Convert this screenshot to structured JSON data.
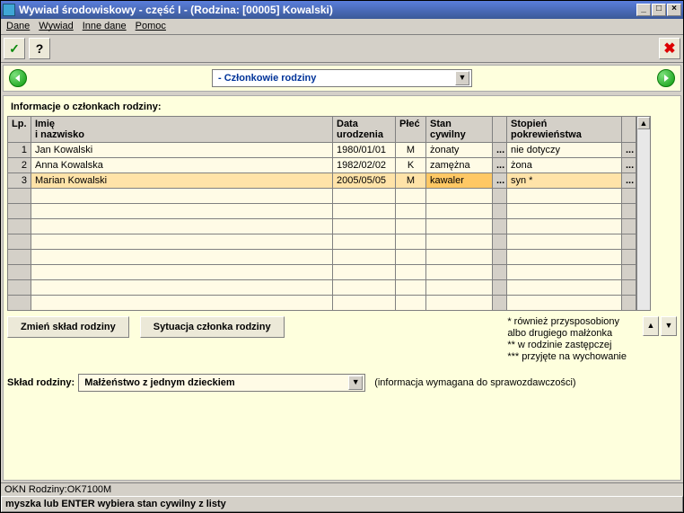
{
  "window": {
    "title": "Wywiad środowiskowy - część I - (Rodzina: [00005] Kowalski)"
  },
  "menu": {
    "items": [
      "Dane",
      "Wywiad",
      "Inne dane",
      "Pomoc"
    ]
  },
  "toolbar": {
    "ok_icon": "✓",
    "help_icon": "?",
    "close_icon": "✖"
  },
  "nav": {
    "select_label": "- Członkowie rodziny"
  },
  "section": {
    "title": "Informacje o członkach rodziny:"
  },
  "columns": {
    "lp": "Lp.",
    "name_line1": "Imię",
    "name_line2": "i nazwisko",
    "dob_line1": "Data",
    "dob_line2": "urodzenia",
    "sex": "Płeć",
    "marital_line1": "Stan",
    "marital_line2": "cywilny",
    "kinship_line1": "Stopień",
    "kinship_line2": "pokrewieństwa"
  },
  "rows": [
    {
      "lp": "1",
      "name": "Jan Kowalski",
      "dob": "1980/01/01",
      "sex": "M",
      "marital": "żonaty",
      "kinship": "nie dotyczy"
    },
    {
      "lp": "2",
      "name": "Anna Kowalska",
      "dob": "1982/02/02",
      "sex": "K",
      "marital": "zamężna",
      "kinship": "żona"
    },
    {
      "lp": "3",
      "name": "Marian Kowalski",
      "dob": "2005/05/05",
      "sex": "M",
      "marital": "kawaler",
      "kinship": "syn *"
    }
  ],
  "buttons": {
    "change_family": "Zmień skład rodziny",
    "member_situation": "Sytuacja członka rodziny"
  },
  "footnotes": {
    "l1": "* również przysposobiony",
    "l2": "albo drugiego małżonka",
    "l3": "** w rodzinie zastępczej",
    "l4": "*** przyjęte na wychowanie"
  },
  "sklad": {
    "label": "Skład rodziny:",
    "value": "Małżeństwo z jednym dzieckiem",
    "hint": "(informacja wymagana do sprawozdawczości)"
  },
  "footer": {
    "form_id": "OKN Rodziny:OK7100M"
  },
  "status": {
    "text": "myszka lub ENTER wybiera stan cywilny z listy"
  },
  "ellipsis": "..."
}
